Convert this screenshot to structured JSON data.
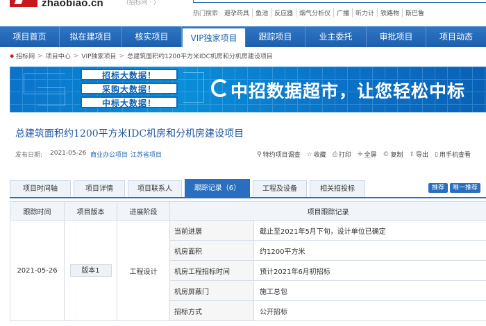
{
  "header": {
    "logo_text": "zhaobiao.cn",
    "slogan": "(招标网 · )",
    "hot_label": "热门搜索:",
    "hot_items": [
      "避孕药具",
      "鱼池",
      "反应器",
      "烟气分析仪",
      "广播",
      "听力计",
      "铁路物",
      "斯巴鲁"
    ]
  },
  "nav": {
    "items": [
      "项目首页",
      "拟在建项目",
      "核实项目",
      "VIP独家项目",
      "跟踪项目",
      "业主委托",
      "审批项目",
      "项目动态"
    ],
    "active_index": 3
  },
  "breadcrumb": [
    "招标网",
    "项目中心",
    "VIP独家项目",
    "总建筑面积约1200平方米IDC机房和分机房建设项目"
  ],
  "banner": {
    "pills": [
      "招标大数据！",
      "采购大数据！",
      "中标大数据！"
    ],
    "slogan": "中招数据超市，让您轻松中标"
  },
  "project": {
    "title": "总建筑面积约1200平方米IDC机房和分机房建设项目",
    "date_label": "发布日期:",
    "date": "2021-05-26",
    "category": "商业办公项目",
    "region": "江苏省项目"
  },
  "tools": [
    {
      "icon": "search-icon",
      "label": "特约项目调查"
    },
    {
      "icon": "star-icon",
      "label": "收藏"
    },
    {
      "icon": "print-icon",
      "label": "打印"
    },
    {
      "icon": "fullscreen-icon",
      "label": "全屏"
    },
    {
      "icon": "copy-icon",
      "label": "复制"
    },
    {
      "icon": "export-icon",
      "label": "导出"
    },
    {
      "icon": "phone-icon",
      "label": "用手机查看"
    }
  ],
  "tabs": [
    "项目时间轴",
    "项目详情",
    "项目联系人",
    "跟踪记录（6）",
    "工程及设备",
    "相关招投标"
  ],
  "active_tab": 3,
  "side_buttons": [
    "推荐",
    "唯一推荐"
  ],
  "table": {
    "headers": [
      "跟踪时间",
      "项目版本",
      "进展阶段",
      "项目跟踪记录"
    ],
    "date": "2021-05-26",
    "version": "版本1",
    "stage": "工程设计",
    "rows": [
      {
        "field": "当前进展",
        "value": "截止至2021年5月下旬，设计单位已确定"
      },
      {
        "field": "机房面积",
        "value": "约1200平方米"
      },
      {
        "field": "机房工程招标时间",
        "value": "预计2021年6月初招标"
      },
      {
        "field": "机房屏蔽门",
        "value": "施工总包"
      },
      {
        "field": "招标方式",
        "value": "公开招标"
      }
    ]
  },
  "colors": {
    "nav_blue": "#1f64b1",
    "brand_red": "#c8161d",
    "tab_active": "#2a6fbf",
    "title_blue": "#1e55a0"
  }
}
